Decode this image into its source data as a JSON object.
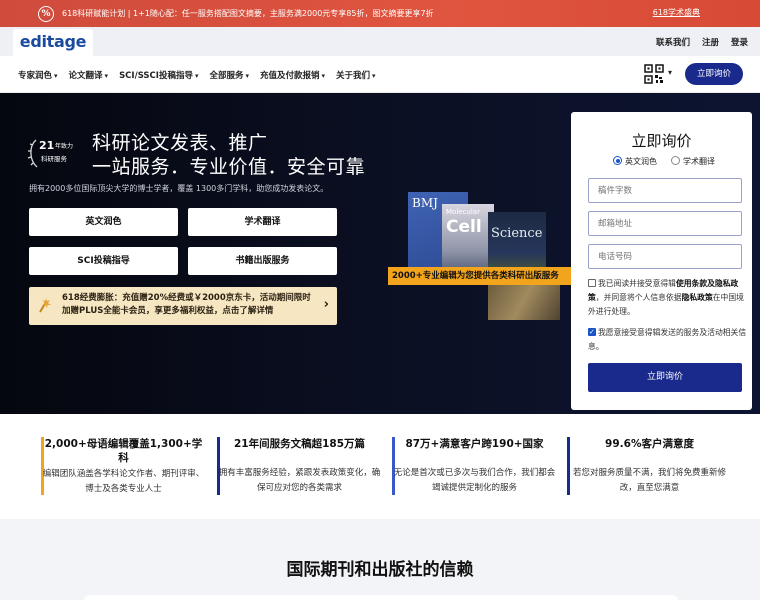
{
  "promo": {
    "icon": "percent-icon",
    "text": "618科研赋能计划 | 1+1随心配：任一服务搭配图文摘要，主服务满2000元专享85折，图文摘要更享7折",
    "link": "618学术盛典",
    "bg": "#d9503c"
  },
  "header": {
    "logo": "editage",
    "links": [
      "联系我们",
      "注册",
      "登录"
    ]
  },
  "nav": {
    "items": [
      "专家润色",
      "论文翻译",
      "SCI/SSCI投稿指导",
      "全部服务",
      "充值及付款报销",
      "关于我们"
    ],
    "cta": "立即询价",
    "accent": "#1a2a8c"
  },
  "hero": {
    "badge_num": "21",
    "badge_year": "年致力",
    "badge_sub": "科研服务",
    "title1": "科研论文发表、推广",
    "title2": "一站服务．专业价值．安全可靠",
    "subtitle": "拥有2000多位国际顶尖大学的博士学者，覆盖 1300多门学科，助您成功发表论文。",
    "buttons": [
      "英文润色",
      "学术翻译",
      "SCI投稿指导",
      "书籍出版服务"
    ],
    "promo_card": "618经费膨胀：充值赠20%经费或￥2000京东卡，活动期间限时加赠PLUS全能卡会员，享更多福利权益，点击了解详情",
    "journals": {
      "bmj": "BMJ",
      "cell_small": "Molecular",
      "cell_big": "Cell",
      "science": "Science",
      "banner": "2000+专业编辑为您提供各类科研出版服务"
    }
  },
  "form": {
    "title": "立即询价",
    "radios": [
      "英文润色",
      "学术翻译"
    ],
    "placeholders": [
      "稿件字数",
      "邮箱地址",
      "电话号码"
    ],
    "consent1_a": "我已阅读并接受意得辑",
    "consent1_b": "使用条款及",
    "consent1_c": "隐私政策",
    "consent1_d": "，并同意将个人信息依据",
    "consent1_e": "隐私政策",
    "consent1_f": "在中国境外进行处理。",
    "consent2": "我愿意接受意得辑发送的服务及活动相关信息。",
    "submit": "立即询价"
  },
  "stats": [
    {
      "title": "2,000+母语编辑覆盖1,300+学科",
      "desc": "编辑团队涵盖各学科论文作者、期刊评审、博士及各类专业人士",
      "color": "#f2a51c"
    },
    {
      "title": "21年间服务文稿超185万篇",
      "desc": "拥有丰富服务经验，紧跟发表政策变化，确保可应对您的各类需求",
      "color": "#1a2a8c"
    },
    {
      "title": "87万+满意客户跨190+国家",
      "desc": "无论是首次或已多次与我们合作，我们都会竭诚提供定制化的服务",
      "color": "#3a58c8"
    },
    {
      "title": "99.6%客户满意度",
      "desc": "若您对服务质量不满，我们将免费重新修改，直至您满意",
      "color": "#1a2a8c"
    }
  ],
  "bottom": {
    "title": "国际期刊和出版社的信赖"
  }
}
